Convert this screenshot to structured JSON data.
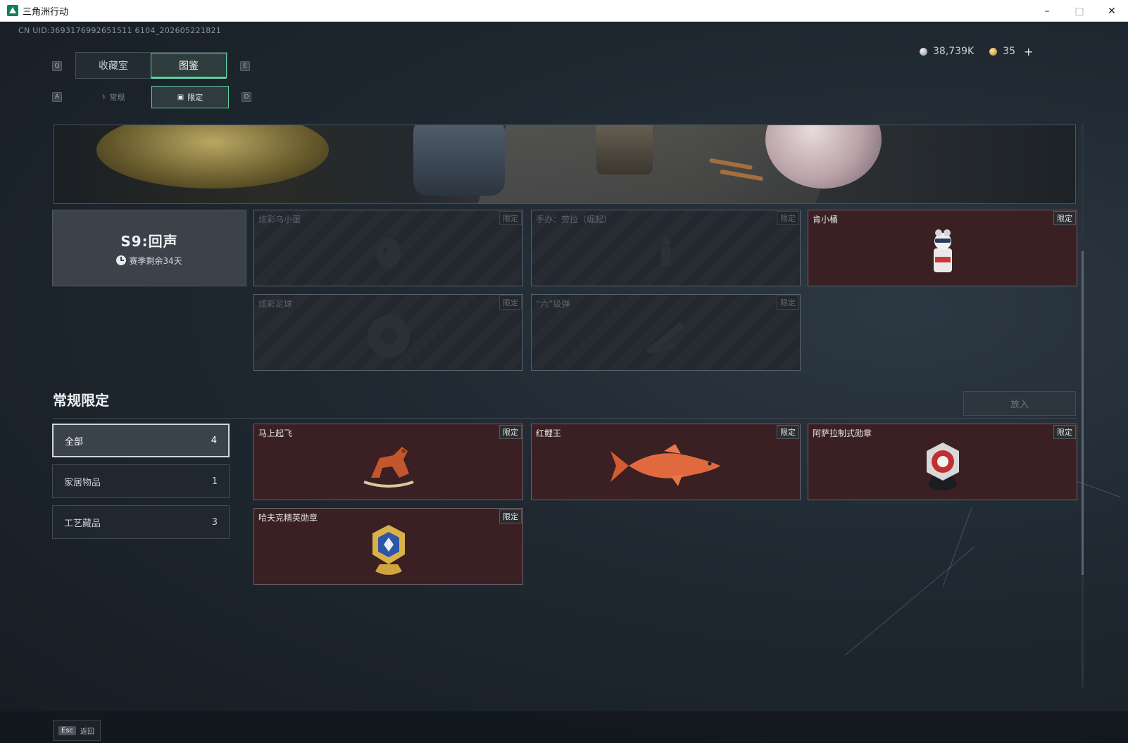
{
  "window": {
    "title": "三角洲行动"
  },
  "uid": "CN UID:3693176992651511 6104_202605221821",
  "currency": {
    "silver": "38,739K",
    "gold": "35",
    "plus": "+"
  },
  "keys": {
    "q": "Q",
    "e": "E",
    "a": "A",
    "d": "D"
  },
  "tabs_main": [
    {
      "label": "收藏室"
    },
    {
      "label": "图鉴"
    }
  ],
  "tabs_sub": [
    {
      "label": "常规"
    },
    {
      "label": "限定"
    }
  ],
  "season": {
    "title": "S9:回声",
    "remaining": "赛季剩余34天"
  },
  "season_items": [
    {
      "name": "炫彩乌小蛋",
      "tag": "限定",
      "state": "locked"
    },
    {
      "name": "手办：劳拉（崛起）",
      "tag": "限定",
      "state": "locked"
    },
    {
      "name": "肯小桶",
      "tag": "限定",
      "state": "owned"
    },
    {
      "name": "炫彩足球",
      "tag": "限定",
      "state": "locked"
    },
    {
      "name": "“六”级弹",
      "tag": "限定",
      "state": "locked"
    }
  ],
  "section": {
    "title": "常规限定",
    "put_button": "放入"
  },
  "filters": [
    {
      "label": "全部",
      "count": "4"
    },
    {
      "label": "家居物品",
      "count": "1"
    },
    {
      "label": "工艺藏品",
      "count": "3"
    }
  ],
  "regular_items": [
    {
      "name": "马上起飞",
      "tag": "限定"
    },
    {
      "name": "红鲤王",
      "tag": "限定"
    },
    {
      "name": "阿萨拉制式勋章",
      "tag": "限定"
    },
    {
      "name": "哈夫克精英勋章",
      "tag": "限定"
    }
  ],
  "footer": {
    "esc_key": "Esc",
    "back_label": "返回"
  },
  "icons": {
    "app": "delta-force-app-icon",
    "minimize": "minimize-icon",
    "maximize": "maximize-icon",
    "close": "close-icon",
    "silver_coin": "silver-coin-icon",
    "gold_coin": "gold-coin-icon",
    "clock": "clock-icon"
  },
  "colors": {
    "accent": "#5bd1a4",
    "owned_card": "#3a1f23",
    "locked_card": "#22282e"
  }
}
